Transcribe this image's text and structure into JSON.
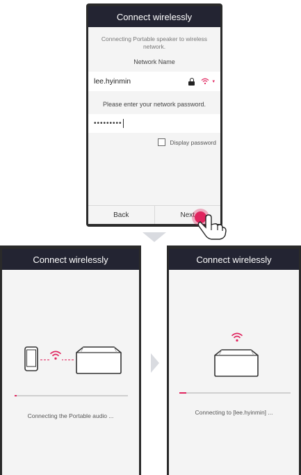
{
  "top_screen": {
    "title": "Connect wirelessly",
    "description": "Connecting Portable speaker to wireless network.",
    "network_label": "Network Name",
    "network_name": "lee.hyinmin",
    "password_prompt": "Please enter your network password.",
    "password_value": "•••••••••",
    "display_password_label": "Display password",
    "display_password_checked": false,
    "back_label": "Back",
    "next_label": "Next"
  },
  "left_screen": {
    "title": "Connect wirelessly",
    "status": "Connecting the Portable audio ...",
    "progress": 0.02
  },
  "right_screen": {
    "title": "Connect wirelessly",
    "status": "Connecting to [lee.hyinmin] ...",
    "progress": 0.06
  },
  "icons": {
    "lock": "lock-icon",
    "wifi": "wifi-icon",
    "phone": "smartphone-icon",
    "speaker": "speaker-icon",
    "hand": "hand-pointer-icon"
  },
  "colors": {
    "title_bar": "#232432",
    "accent": "#e0245e",
    "screen_bg": "#f4f4f4"
  }
}
